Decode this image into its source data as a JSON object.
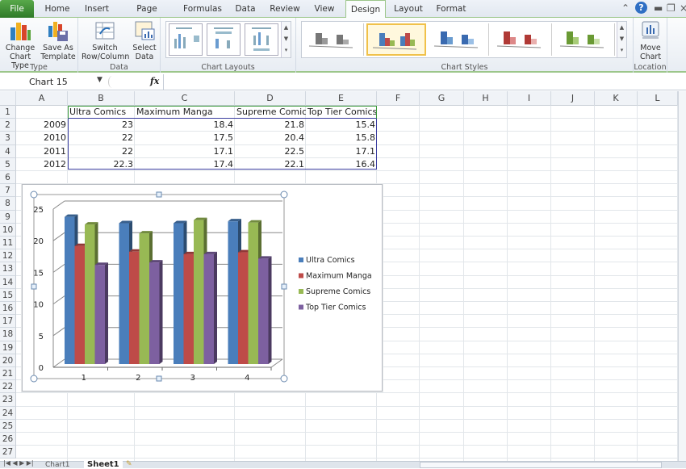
{
  "ribbon_tabs": [
    {
      "label": "File",
      "active": false
    },
    {
      "label": "Home",
      "active": false
    },
    {
      "label": "Insert",
      "active": false
    },
    {
      "label": "Page Layout",
      "active": false
    },
    {
      "label": "Formulas",
      "active": false
    },
    {
      "label": "Data",
      "active": false
    },
    {
      "label": "Review",
      "active": false
    },
    {
      "label": "View",
      "active": false
    },
    {
      "label": "Design",
      "active": true
    },
    {
      "label": "Layout",
      "active": false
    },
    {
      "label": "Format",
      "active": false
    }
  ],
  "ribbon": {
    "type_group": {
      "label": "Type",
      "change_chart_type": "Change\nChart Type",
      "save_as_template": "Save As\nTemplate"
    },
    "data_group": {
      "label": "Data",
      "switch_row_column": "Switch\nRow/Column",
      "select_data": "Select\nData"
    },
    "layouts_group": {
      "label": "Chart Layouts"
    },
    "styles_group": {
      "label": "Chart Styles",
      "styles": [
        "gray",
        "multicolor",
        "blue",
        "red",
        "green"
      ],
      "selected": "multicolor"
    },
    "location_group": {
      "label": "Location",
      "move_chart": "Move\nChart"
    }
  },
  "formula_bar": {
    "name_box": "Chart 15",
    "fx": "fx",
    "formula": ""
  },
  "columns": [
    "A",
    "B",
    "C",
    "D",
    "E",
    "F",
    "G",
    "H",
    "I",
    "J",
    "K",
    "L"
  ],
  "rows": [
    "1",
    "2",
    "3",
    "4",
    "5",
    "6",
    "7",
    "8",
    "9",
    "10",
    "11",
    "12",
    "13",
    "14",
    "15",
    "16",
    "17",
    "18",
    "19",
    "20",
    "21",
    "22",
    "23",
    "24",
    "25",
    "26",
    "27"
  ],
  "table": {
    "headers": [
      "",
      "Ultra Comics",
      "Maximum Manga",
      "Supreme Comics",
      "Top Tier Comics"
    ],
    "rows": [
      [
        "2009",
        "23",
        "18.4",
        "21.8",
        "15.4"
      ],
      [
        "2010",
        "22",
        "17.5",
        "20.4",
        "15.8"
      ],
      [
        "2011",
        "22",
        "17.1",
        "22.5",
        "17.1"
      ],
      [
        "2012",
        "22.3",
        "17.4",
        "22.1",
        "16.4"
      ]
    ]
  },
  "sheet_tabs": [
    {
      "label": "Chart1",
      "active": false
    },
    {
      "label": "Sheet1",
      "active": true
    }
  ],
  "chart_data": {
    "type": "bar",
    "title": "",
    "categories": [
      "1",
      "2",
      "3",
      "4"
    ],
    "series": [
      {
        "name": "Ultra Comics",
        "color": "#4a7ebb",
        "values": [
          23,
          22,
          22,
          22.3
        ]
      },
      {
        "name": "Maximum Manga",
        "color": "#be4b48",
        "values": [
          18.4,
          17.5,
          17.1,
          17.4
        ]
      },
      {
        "name": "Supreme Comics",
        "color": "#98b954",
        "values": [
          21.8,
          20.4,
          22.5,
          22.1
        ]
      },
      {
        "name": "Top Tier Comics",
        "color": "#7d60a0",
        "values": [
          15.4,
          15.8,
          17.1,
          16.4
        ]
      }
    ],
    "yticks": [
      "0",
      "5",
      "10",
      "15",
      "20",
      "25"
    ],
    "ylim": [
      0,
      25
    ],
    "xlabel": "",
    "ylabel": "",
    "grid": true,
    "legend": "right",
    "style": "3D clustered column"
  }
}
